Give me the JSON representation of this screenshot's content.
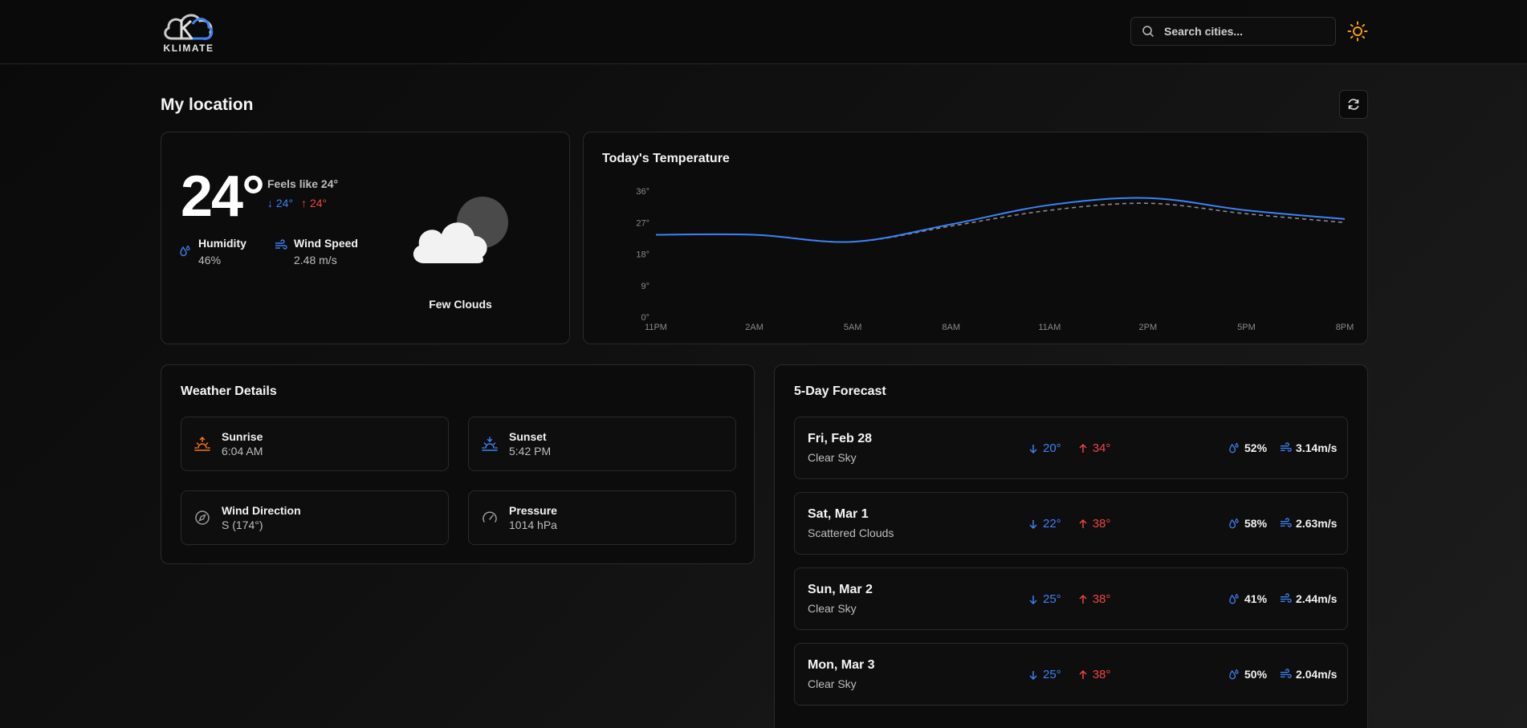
{
  "header": {
    "logo_text": "KLIMATE",
    "search": {
      "placeholder": "Search cities..."
    }
  },
  "page": {
    "title": "My location"
  },
  "current": {
    "temperature": "24°",
    "feels_like": "Feels like 24°",
    "min": "24°",
    "max": "24°",
    "humidity_label": "Humidity",
    "humidity_value": "46%",
    "wind_label": "Wind Speed",
    "wind_value": "2.48 m/s",
    "condition": "Few Clouds"
  },
  "chart_data": {
    "type": "line",
    "title": "Today's Temperature",
    "xlabel": "",
    "ylabel": "",
    "x": [
      "11PM",
      "2AM",
      "5AM",
      "8AM",
      "11AM",
      "2PM",
      "5PM",
      "8PM"
    ],
    "y_ticks": [
      "0°",
      "9°",
      "18°",
      "27°",
      "36°"
    ],
    "ylim": [
      0,
      36
    ],
    "grid": false,
    "legend": "none",
    "series": [
      {
        "values": [
          23.5,
          23.5,
          21.5,
          26.5,
          32,
          34,
          30.5,
          28
        ],
        "color": "#3b82f6",
        "style": "solid"
      },
      {
        "values": [
          23.5,
          23.5,
          21.5,
          26,
          30.5,
          32.5,
          29.5,
          27
        ],
        "color": "#8a8a8a",
        "style": "dashed"
      }
    ]
  },
  "details": {
    "title": "Weather Details",
    "items": [
      {
        "label": "Sunrise",
        "value": "6:04 AM"
      },
      {
        "label": "Sunset",
        "value": "5:42 PM"
      },
      {
        "label": "Wind Direction",
        "value": "S (174°)"
      },
      {
        "label": "Pressure",
        "value": "1014 hPa"
      }
    ]
  },
  "forecast": {
    "title": "5-Day Forecast",
    "days": [
      {
        "date": "Fri, Feb 28",
        "desc": "Clear Sky",
        "min": "20°",
        "max": "34°",
        "humidity": "52%",
        "wind": "3.14m/s"
      },
      {
        "date": "Sat, Mar 1",
        "desc": "Scattered Clouds",
        "min": "22°",
        "max": "38°",
        "humidity": "58%",
        "wind": "2.63m/s"
      },
      {
        "date": "Sun, Mar 2",
        "desc": "Clear Sky",
        "min": "25°",
        "max": "38°",
        "humidity": "41%",
        "wind": "2.44m/s"
      },
      {
        "date": "Mon, Mar 3",
        "desc": "Clear Sky",
        "min": "25°",
        "max": "38°",
        "humidity": "50%",
        "wind": "2.04m/s"
      }
    ]
  },
  "colors": {
    "accent": "#3b82f6",
    "high": "#ef4444",
    "sunrise": "#f97316",
    "sun_toggle": "#f59e0b"
  }
}
